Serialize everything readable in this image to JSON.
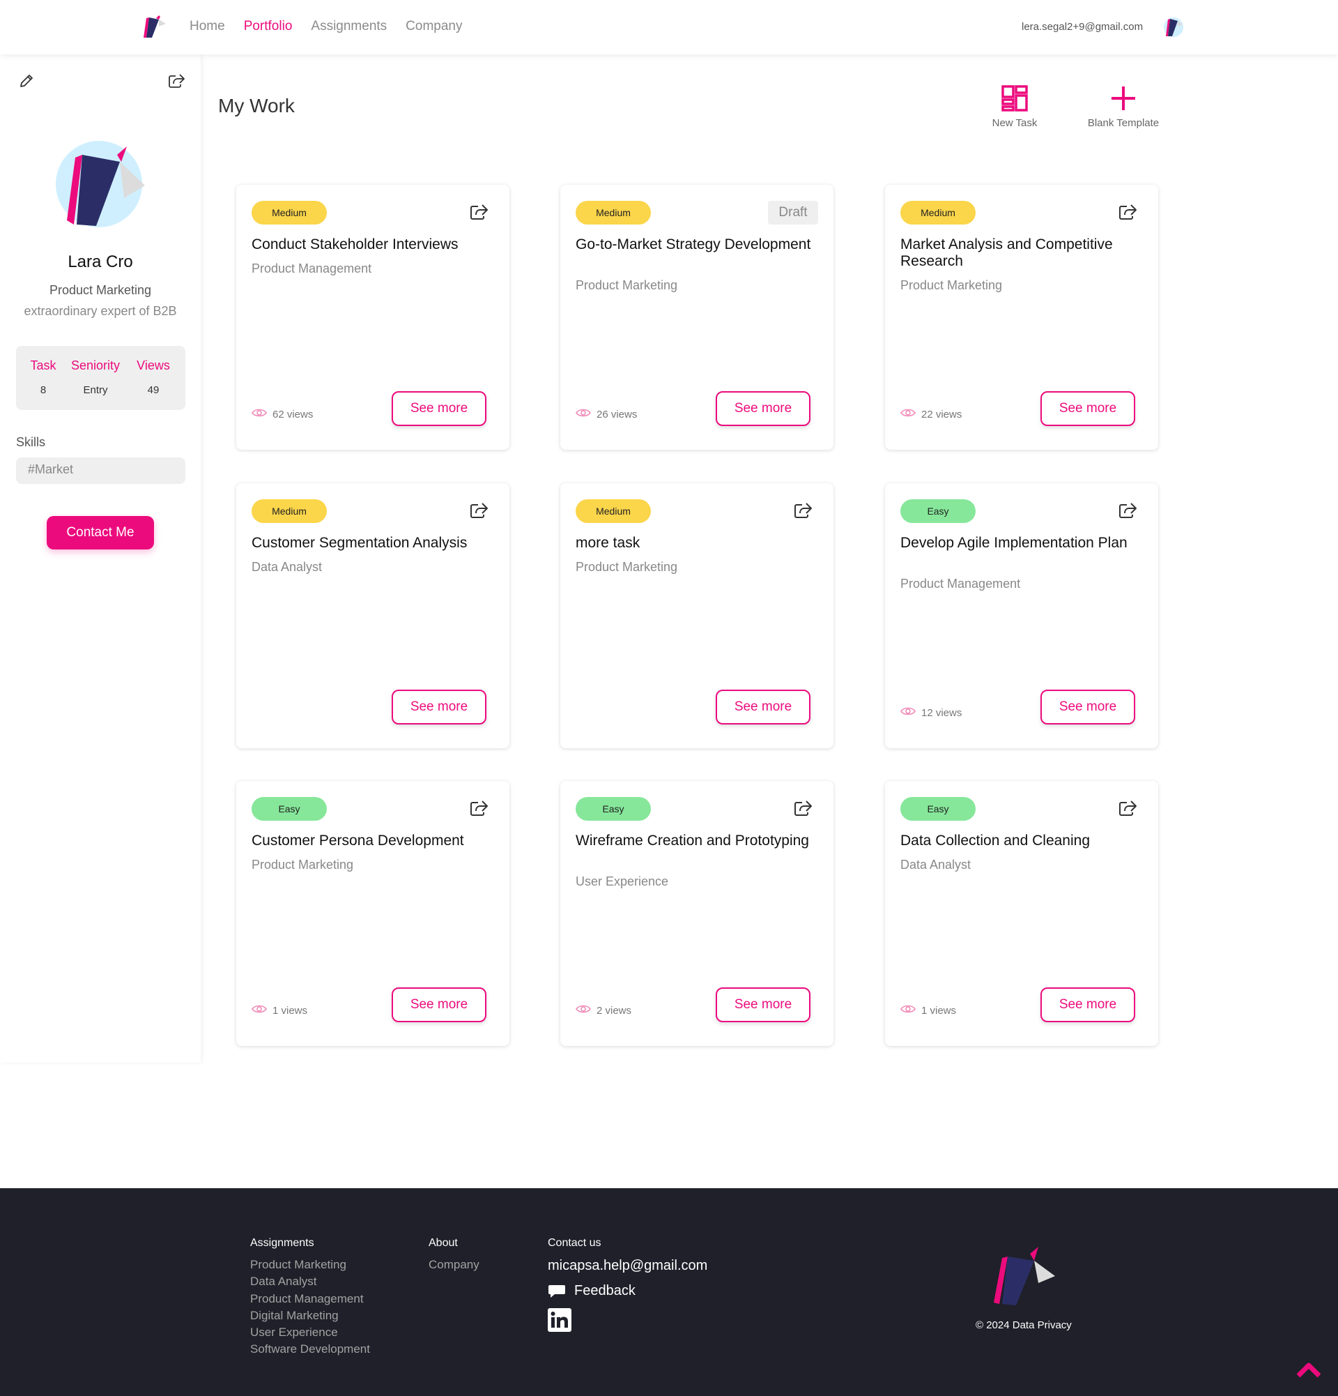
{
  "brand": {
    "accent": "#ec0b7d",
    "navy": "#2b2e66",
    "footer_bg": "#1f2029"
  },
  "nav": {
    "items": [
      "Home",
      "Portfolio",
      "Assignments",
      "Company"
    ],
    "active": "Portfolio",
    "user_email": "lera.segal2+9@gmail.com"
  },
  "profile": {
    "name": "Lara Cro",
    "role": "Product Marketing",
    "bio": "extraordinary expert of B2B",
    "stats": [
      {
        "label": "Task",
        "value": "8"
      },
      {
        "label": "Seniority",
        "value": "Entry"
      },
      {
        "label": "Views",
        "value": "49"
      }
    ],
    "skills_label": "Skills",
    "skill": "#Market",
    "contact_label": "Contact Me"
  },
  "main": {
    "title": "My Work",
    "tools": [
      {
        "label": "New Task",
        "icon": "grid-icon"
      },
      {
        "label": "Blank Template",
        "icon": "plus-icon"
      }
    ],
    "see_more_label": "See more"
  },
  "cards": [
    {
      "difficulty": "Medium",
      "title": "Conduct Stakeholder Interviews",
      "category": "Product Management",
      "views": "62 views",
      "draft": ""
    },
    {
      "difficulty": "Medium",
      "title": "Go-to-Market Strategy Development",
      "category": "Product Marketing",
      "views": "26 views",
      "draft": "Draft"
    },
    {
      "difficulty": "Medium",
      "title": "Market Analysis and Competitive Research",
      "category": "Product Marketing",
      "views": "22 views",
      "draft": ""
    },
    {
      "difficulty": "Medium",
      "title": "Customer Segmentation Analysis",
      "category": "Data Analyst",
      "views": "",
      "draft": ""
    },
    {
      "difficulty": "Medium",
      "title": "more task",
      "category": "Product Marketing",
      "views": "",
      "draft": ""
    },
    {
      "difficulty": "Easy",
      "title": "Develop Agile Implementation Plan",
      "category": "Product Management",
      "views": "12 views",
      "draft": ""
    },
    {
      "difficulty": "Easy",
      "title": "Customer Persona Development",
      "category": "Product Marketing",
      "views": "1 views",
      "draft": ""
    },
    {
      "difficulty": "Easy",
      "title": "Wireframe Creation and Prototyping",
      "category": "User Experience",
      "views": "2 views",
      "draft": ""
    },
    {
      "difficulty": "Easy",
      "title": "Data Collection and Cleaning",
      "category": "Data Analyst",
      "views": "1 views",
      "draft": ""
    }
  ],
  "footer": {
    "assignments_head": "Assignments",
    "assignments": [
      "Product Marketing",
      "Data Analyst",
      "Product Management",
      "Digital Marketing",
      "User Experience",
      "Software Development"
    ],
    "about_head": "About",
    "about": [
      "Company"
    ],
    "contact_head": "Contact us",
    "email": "micapsa.help@gmail.com",
    "feedback": "Feedback",
    "copyright": "© 2024 Data Privacy"
  }
}
